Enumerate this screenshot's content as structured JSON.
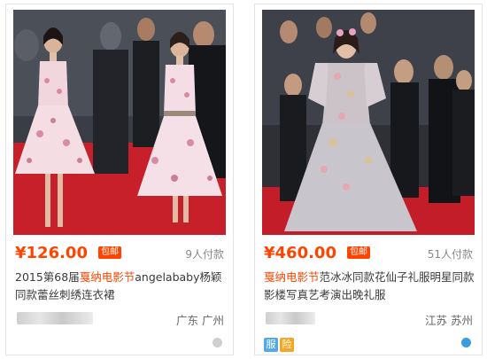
{
  "products": [
    {
      "price": "¥126.00",
      "free_shipping_tag": "包邮",
      "payers": "9人付款",
      "title_before": "2015第68届",
      "title_highlight": "戛纳电影节",
      "title_after": "angelababy杨颖同款蕾丝刺绣连衣裙",
      "location": "广东 广州",
      "status_color": "#cfcfcf"
    },
    {
      "price": "¥460.00",
      "free_shipping_tag": "包邮",
      "payers": "51人付款",
      "title_before": "",
      "title_highlight": "戛纳电影节",
      "title_after": "范冰冰同款花仙子礼服明星同款影楼写真艺考演出晚礼服",
      "location": "江苏 苏州",
      "badges": [
        "服",
        "险"
      ],
      "badge_colors": [
        "#53a9e8",
        "#f5a623"
      ],
      "status_color": "#3a9be0"
    }
  ]
}
